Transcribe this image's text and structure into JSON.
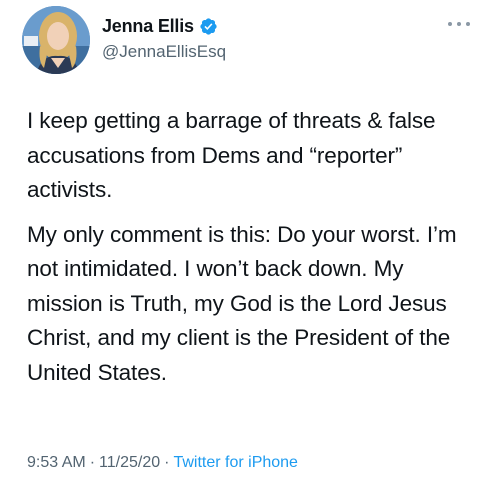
{
  "author": {
    "display_name": "Jenna Ellis",
    "handle": "@JennaEllisEsq",
    "verified_icon": "verified-badge-icon",
    "avatar": "profile-photo"
  },
  "tweet": {
    "paragraph_1": "I keep getting a barrage of threats & false accusations from Dems and “reporter” activists.",
    "paragraph_2": "My only comment is this: Do your worst. I’m not intimidated. I won’t back down. My mission is Truth, my God is the Lord Jesus Christ, and my client is the President of the United States."
  },
  "meta": {
    "time": "9:53 AM",
    "separator": "·",
    "date": "11/25/20",
    "source": "Twitter for iPhone"
  },
  "colors": {
    "accent": "#1d9bf0",
    "secondary_text": "#536471",
    "primary_text": "#0f1419"
  }
}
